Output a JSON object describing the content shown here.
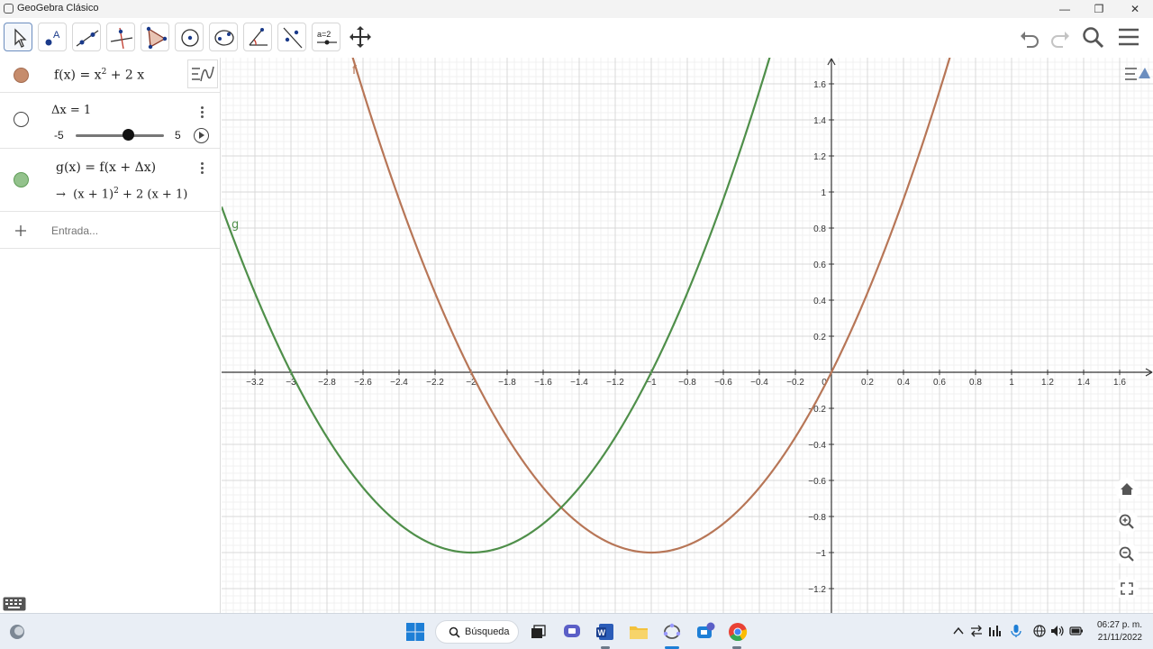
{
  "window": {
    "title": "GeoGebra Clásico",
    "minimize": "—",
    "maximize": "❐",
    "close": "✕"
  },
  "toolbar": {
    "tools": [
      {
        "name": "move-tool",
        "icon": "pointer-arrow-icon"
      },
      {
        "name": "point-tool",
        "icon": "point-icon"
      },
      {
        "name": "line-tool",
        "icon": "line-icon"
      },
      {
        "name": "perpendicular-line-tool",
        "icon": "perpendicular-icon"
      },
      {
        "name": "polygon-tool",
        "icon": "polygon-icon"
      },
      {
        "name": "circle-tool",
        "icon": "circle-center-icon"
      },
      {
        "name": "ellipse-tool",
        "icon": "ellipse-icon"
      },
      {
        "name": "angle-tool",
        "icon": "angle-icon"
      },
      {
        "name": "reflect-tool",
        "icon": "reflect-icon"
      },
      {
        "name": "slider-tool",
        "icon": "slider-icon",
        "label": "a=2"
      },
      {
        "name": "move-graphics-tool",
        "icon": "move-view-icon"
      }
    ],
    "right": [
      "undo-icon",
      "redo-icon",
      "search-icon",
      "menu-icon"
    ]
  },
  "algebra": {
    "f": {
      "color": "#c68c6c",
      "lhs": "f(x)",
      "eq": "=",
      "rhs_base": "x",
      "rhs_exp": "2",
      "rhs_tail": "+ 2 x"
    },
    "slider": {
      "label": "Δx = 1",
      "min": "-5",
      "max": "5",
      "value": 1
    },
    "g": {
      "color": "#93c28c",
      "def": "g(x) = f(x + Δx)",
      "arrow": "→",
      "res_a": "(x + 1)",
      "res_exp": "2",
      "res_b": "+ 2 (x + 1)"
    },
    "input_placeholder": "Entrada..."
  },
  "graphics": {
    "x_ticks": [
      "-3.2",
      "-3",
      "-2.8",
      "-2.6",
      "-2.4",
      "-2.2",
      "-2",
      "-1.8",
      "-1.6",
      "-1.4",
      "-1.2",
      "-1",
      "-0.8",
      "-0.6",
      "-0.4",
      "-0.2",
      "0",
      "0.2",
      "0.4",
      "0.6",
      "0.8",
      "1",
      "1.2",
      "1.4",
      "1.6"
    ],
    "y_ticks": [
      "1.6",
      "1.4",
      "1.2",
      "1",
      "0.8",
      "0.6",
      "0.4",
      "0.2",
      "-0.2",
      "-0.4",
      "-0.6",
      "-0.8",
      "-1",
      "-1.2"
    ],
    "f_label": "f",
    "g_label": "g",
    "f_color": "#b77657",
    "g_color": "#4f8f4a",
    "side_buttons": [
      "home-icon",
      "zoom-in-icon",
      "zoom-out-icon",
      "fullscreen-icon"
    ]
  },
  "taskbar": {
    "search": "Búsqueda",
    "time": "06:27 p. m.",
    "date": "21/11/2022"
  }
}
